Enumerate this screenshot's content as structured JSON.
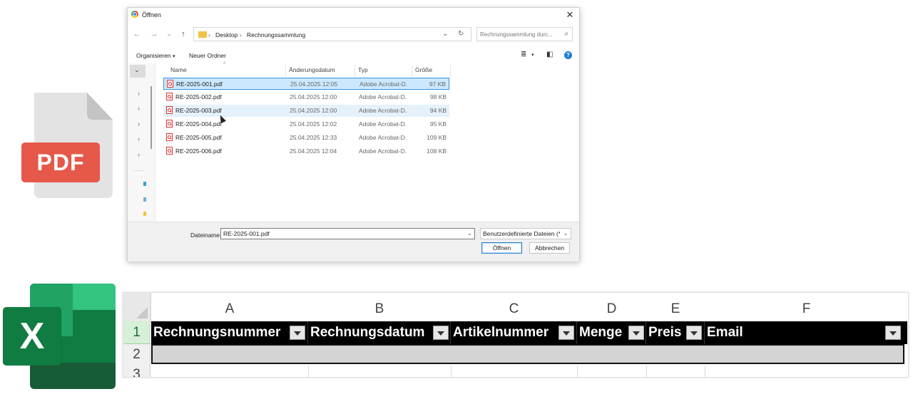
{
  "dialog": {
    "title": "Öffnen",
    "address": {
      "segments": [
        "Desktop",
        "Rechnungssammlung"
      ]
    },
    "search_placeholder": "Rechnungssammlung durc...",
    "toolbar": {
      "organize": "Organisieren",
      "new_folder": "Neuer Ordner"
    },
    "columns": {
      "name": "Name",
      "modified": "Änderungsdatum",
      "type": "Typ",
      "size": "Größe"
    },
    "files": [
      {
        "name": "RE-2025-001.pdf",
        "modified": "25.04.2025 12:05",
        "type": "Adobe Acrobat-D...",
        "size": "97 KB"
      },
      {
        "name": "RE-2025-002.pdf",
        "modified": "25.04.2025 12:00",
        "type": "Adobe Acrobat-D...",
        "size": "98 KB"
      },
      {
        "name": "RE-2025-003.pdf",
        "modified": "25.04.2025 12:00",
        "type": "Adobe Acrobat-D...",
        "size": "94 KB"
      },
      {
        "name": "RE-2025-004.pdf",
        "modified": "25.04.2025 12:02",
        "type": "Adobe Acrobat-D...",
        "size": "95 KB"
      },
      {
        "name": "RE-2025-005.pdf",
        "modified": "25.04.2025 12:33",
        "type": "Adobe Acrobat-D...",
        "size": "109 KB"
      },
      {
        "name": "RE-2025-006.pdf",
        "modified": "25.04.2025 12:04",
        "type": "Adobe Acrobat-D...",
        "size": "108 KB"
      }
    ],
    "filename_label": "Dateiname:",
    "filename_value": "RE-2025-001.pdf",
    "filetype_value": "Benutzerdefinierte Dateien (*.jp",
    "open_button": "Öffnen",
    "cancel_button": "Abbrechen"
  },
  "pdf_logo": {
    "label": "PDF",
    "color": "#e5584a"
  },
  "excel_logo": {
    "letter": "X",
    "colors": [
      "#33c481",
      "#21a366",
      "#107c41",
      "#185c37"
    ]
  },
  "sheet": {
    "column_letters": [
      "A",
      "B",
      "C",
      "D",
      "E",
      "F"
    ],
    "row_numbers": [
      "1",
      "2",
      "3"
    ],
    "headers": [
      "Rechnungsnummer",
      "Rechnungsdatum",
      "Artikelnummer",
      "Menge",
      "Preis",
      "Email"
    ]
  }
}
